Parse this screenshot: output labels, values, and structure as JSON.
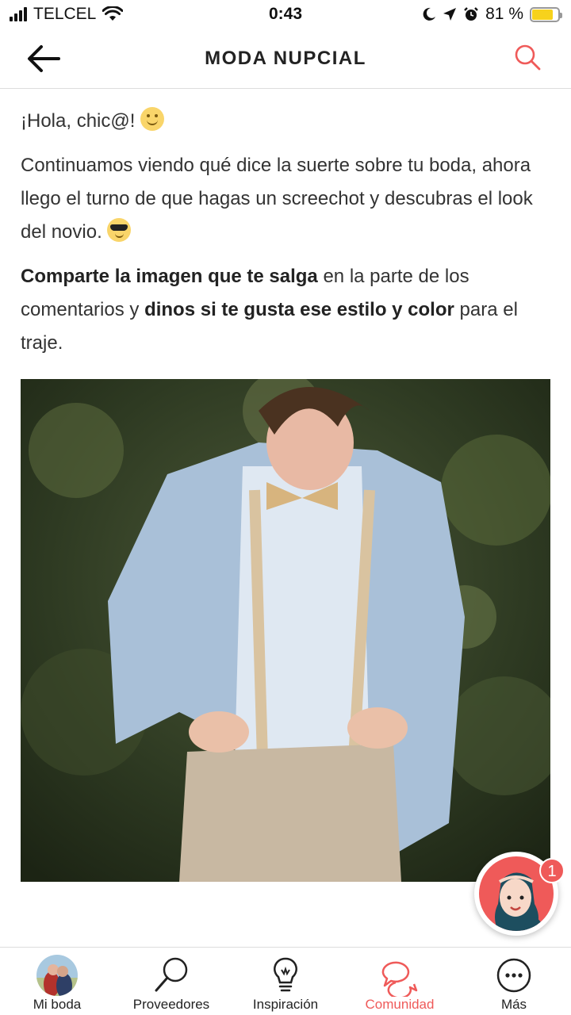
{
  "status_bar": {
    "carrier": "TELCEL",
    "time": "0:43",
    "battery_percent": "81 %",
    "battery_level": 0.81
  },
  "header": {
    "title": "MODA NUPCIAL",
    "back_icon": "back-arrow-icon",
    "search_icon": "search-icon"
  },
  "post": {
    "greeting": "¡Hola, chic@!",
    "paragraph1": "Continuamos viendo qué dice la suerte sobre tu boda, ahora llego el turno de que hagas un screechot y descubras el look del novio.",
    "p2_bold1": "Comparte la imagen que te salga",
    "p2_text1": " en la parte de los comentarios y ",
    "p2_bold2": "dinos si te gusta ese estilo y color",
    "p2_text2": " para el traje."
  },
  "assistant": {
    "badge_count": "1"
  },
  "bottom_nav": {
    "items": [
      {
        "label": "Mi boda",
        "icon": "profile-photo-icon"
      },
      {
        "label": "Proveedores",
        "icon": "magnifier-icon"
      },
      {
        "label": "Inspiración",
        "icon": "lightbulb-icon"
      },
      {
        "label": "Comunidad",
        "icon": "chat-bubbles-icon"
      },
      {
        "label": "Más",
        "icon": "more-icon"
      }
    ],
    "active_index": 3
  },
  "colors": {
    "accent": "#ef5a59",
    "text": "#333333",
    "battery": "#f7d21c"
  }
}
